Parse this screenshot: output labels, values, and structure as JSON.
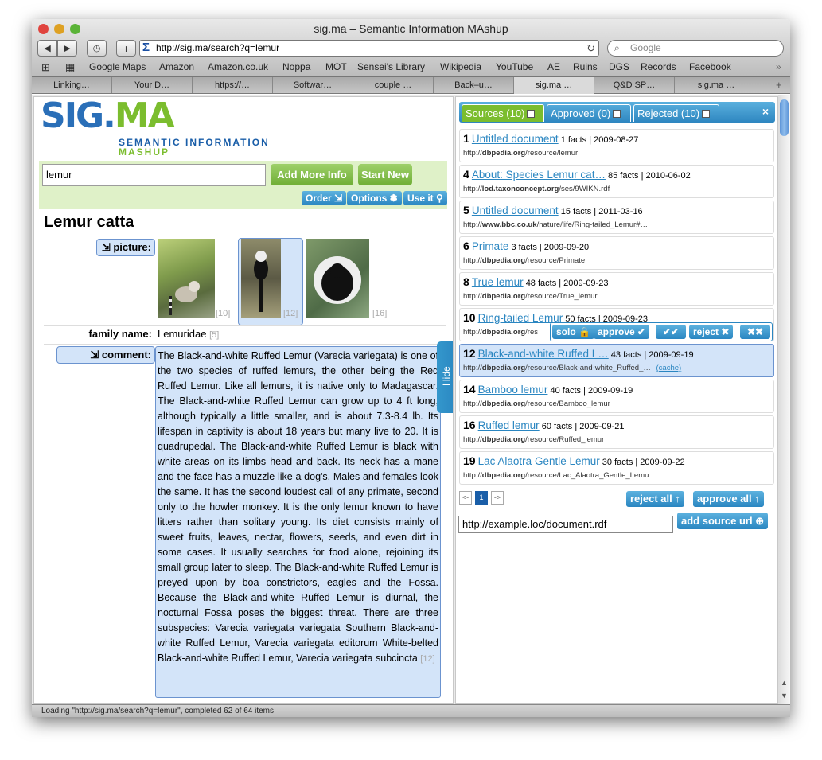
{
  "window": {
    "title": "sig.ma – Semantic Information MAshup"
  },
  "toolbar": {
    "url": "http://sig.ma/search?q=lemur",
    "search_placeholder": "Google"
  },
  "bookmarks": [
    "Google Maps",
    "Amazon",
    "Amazon.co.uk",
    "Noppa",
    "MOT",
    "Sensei's Library",
    "Wikipedia",
    "YouTube",
    "AE",
    "Ruins",
    "DGS",
    "Records",
    "Facebook"
  ],
  "tabs": [
    "Linking…",
    "Your D…",
    "https://…",
    "Softwar…",
    "couple …",
    "Back–u…",
    "sig.ma …",
    "Q&D SP…",
    "sig.ma …"
  ],
  "logo": {
    "line1": "SIG.",
    "line1b": "MA",
    "line2": "SEMANTIC INFORMATION",
    "line3": "MASHUP"
  },
  "search": {
    "value": "lemur",
    "add_more": "Add More Info",
    "start_new": "Start New",
    "order": "Order ⇲",
    "options": "Options ✽",
    "use_it": "Use it ⚲"
  },
  "entity": {
    "title": "Lemur catta",
    "picture_label": "⇲ picture:",
    "pic_refs": [
      "[10]",
      "[12]",
      "[16]"
    ],
    "family_label": "family name:",
    "family_value": "Lemuridae",
    "family_ref": "[5]",
    "comment_label": "⇲ comment:",
    "comment_text": "The Black-and-white Ruffed Lemur (Varecia variegata) is one of the two species of ruffed lemurs, the other being the Red Ruffed Lemur. Like all lemurs, it is native only to Madagascar. The Black-and-white Ruffed Lemur can grow up to 4 ft long, although typically a little smaller, and is about 7.3-8.4 lb. Its lifespan in captivity is about 18 years but many live to 20. It is quadrupedal. The Black-and-white Ruffed Lemur is black with white areas on its limbs head and back. Its neck has a mane and the face has a muzzle like a dog's. Males and females look the same. It has the second loudest call of any primate, second only to the howler monkey. It is the only lemur known to have litters rather than solitary young. Its diet consists mainly of sweet fruits, leaves, nectar, flowers, seeds, and even dirt in some cases. It usually searches for food alone, rejoining its small group later to sleep. The Black-and-white Ruffed Lemur is preyed upon by boa constrictors, eagles and the Fossa. Because the Black-and-white Ruffed Lemur is diurnal, the nocturnal Fossa poses the biggest threat. There are three subspecies: Varecia variegata variegata Southern Black-and-white Ruffed Lemur, Varecia variegata editorum White-belted Black-and-white Ruffed Lemur, Varecia variegata subcincta",
    "comment_ref": "[12]"
  },
  "hide_label": "Hide",
  "sources_tabs": {
    "sources": "Sources (10)",
    "approved": "Approved (0)",
    "rejected": "Rejected (10)",
    "close": "×"
  },
  "sources": [
    {
      "num": "1",
      "title": "Untitled document",
      "meta": "1 facts | 2009-08-27",
      "url_host": "dbpedia.org",
      "url_rest": "/resource/lemur",
      "url_pre": "http://"
    },
    {
      "num": "4",
      "title": "About: Species Lemur cat…",
      "meta": "85 facts | 2010-06-02",
      "url_host": "lod.taxonconcept.org",
      "url_rest": "/ses/9WIKN.rdf",
      "url_pre": "http://"
    },
    {
      "num": "5",
      "title": "Untitled document",
      "meta": "15 facts | 2011-03-16",
      "url_host": "www.bbc.co.uk",
      "url_rest": "/nature/life/Ring-tailed_Lemur#…",
      "url_pre": "http://"
    },
    {
      "num": "6",
      "title": "Primate",
      "meta": "3 facts | 2009-09-20",
      "url_host": "dbpedia.org",
      "url_rest": "/resource/Primate",
      "url_pre": "http://"
    },
    {
      "num": "8",
      "title": "True lemur",
      "meta": "48 facts | 2009-09-23",
      "url_host": "dbpedia.org",
      "url_rest": "/resource/True_lemur",
      "url_pre": "http://"
    },
    {
      "num": "10",
      "title": "Ring-tailed Lemur",
      "meta": "50 facts | 2009-09-23",
      "url_host": "dbpedia.org",
      "url_rest": "/res",
      "url_pre": "http://"
    },
    {
      "num": "12",
      "title": "Black-and-white Ruffed L…",
      "meta": "43 facts | 2009-09-19",
      "url_host": "dbpedia.org",
      "url_rest": "/resource/Black-and-white_Ruffed_…",
      "url_pre": "http://",
      "cache": "(cache)"
    },
    {
      "num": "14",
      "title": "Bamboo lemur",
      "meta": "40 facts | 2009-09-19",
      "url_host": "dbpedia.org",
      "url_rest": "/resource/Bamboo_lemur",
      "url_pre": "http://"
    },
    {
      "num": "16",
      "title": "Ruffed lemur",
      "meta": "60 facts | 2009-09-21",
      "url_host": "dbpedia.org",
      "url_rest": "/resource/Ruffed_lemur",
      "url_pre": "http://"
    },
    {
      "num": "19",
      "title": "Lac Alaotra Gentle Lemur",
      "meta": "30 facts | 2009-09-22",
      "url_host": "dbpedia.org",
      "url_rest": "/resource/Lac_Alaotra_Gentle_Lemu…",
      "url_pre": "http://"
    }
  ],
  "solo_bar": {
    "solo": "solo 🔒",
    "approve": "approve ✔",
    "approve_all": "✔✔",
    "reject": "reject ✖",
    "reject_all": "✖✖"
  },
  "pager": {
    "prev": "<-",
    "page": "1",
    "next": "->"
  },
  "bulk": {
    "reject_all": "reject all ↑",
    "approve_all": "approve all ↑"
  },
  "add_source": {
    "value": "http://example.loc/document.rdf",
    "button": "add source url ⊕"
  },
  "status": "Loading \"http://sig.ma/search?q=lemur\", completed 62 of 64 items",
  "colors": {
    "accent_blue": "#2a86c1",
    "accent_green": "#7bbd2e"
  }
}
